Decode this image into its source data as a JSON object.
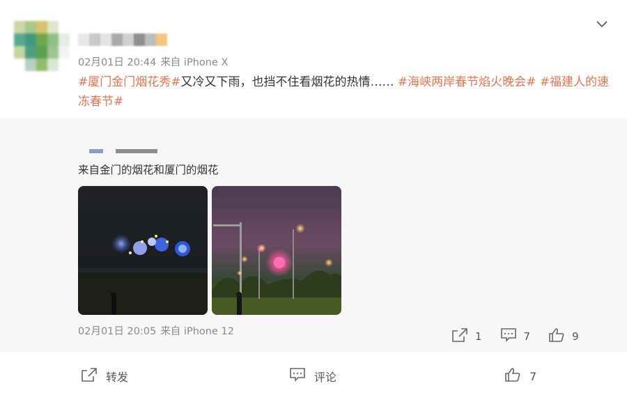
{
  "post": {
    "timestamp": "02月01日 20:44",
    "source": "来自 iPhone X",
    "tag_1": "#厦门金门烟花秀#",
    "text_1": "又冷又下雨，也挡不住看烟花的热情…… ",
    "tag_2": "#海峡两岸春节焰火晚会#",
    "space": " ",
    "tag_3": "#福建人的速冻春节#"
  },
  "repost": {
    "text": "来自金门的烟花和厦门的烟花",
    "timestamp": "02月01日 20:05",
    "source": "来自 iPhone 12",
    "forward_count": "1",
    "comment_count": "7",
    "like_count": "9"
  },
  "footer": {
    "forward_label": "转发",
    "comment_label": "评论",
    "like_count": "7"
  },
  "icons": {
    "menu": "chevron-down-icon",
    "forward": "share-icon",
    "comment": "comment-icon",
    "like": "thumbs-up-icon"
  },
  "colors": {
    "hashtag": "#eb7350",
    "meta_text": "#8a8a8a",
    "repost_bg": "#f7f7f7"
  }
}
